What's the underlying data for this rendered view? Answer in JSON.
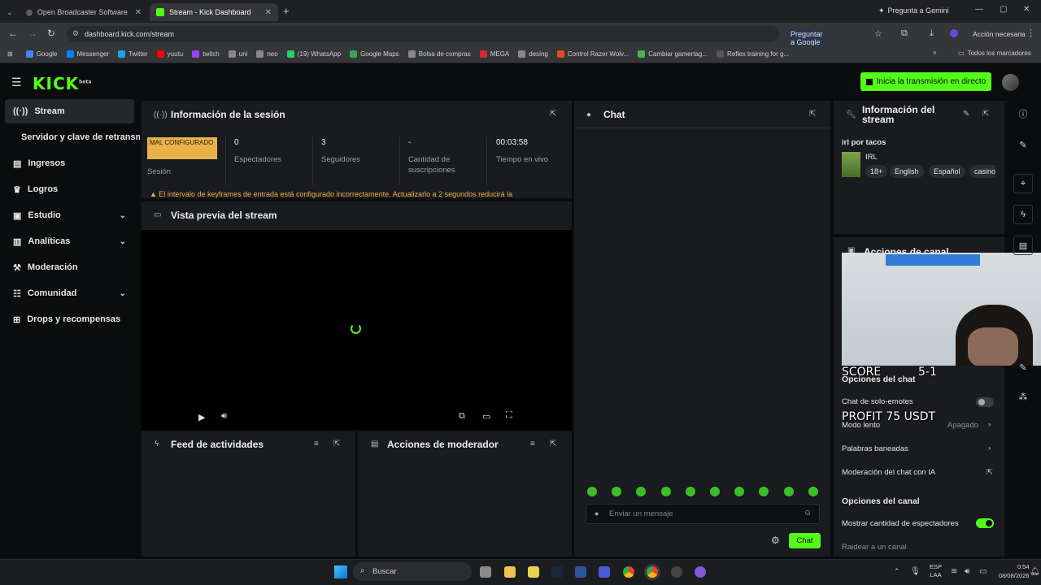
{
  "browser": {
    "tabs": [
      {
        "title": "Open Broadcaster Software | O"
      },
      {
        "title": "Stream - Kick Dashboard"
      }
    ],
    "url": "dashboard.kick.com/stream",
    "ask_google": "Preguntar a Google",
    "gemini": "Pregunta a Gemini",
    "action_needed": "Acción necesaria",
    "bookmarks": [
      "Google",
      "Messenger",
      "Twitter",
      "yuutu",
      "twitch",
      "uni",
      "neo",
      "(19) WhatsApp",
      "Google Maps",
      "Bolsa de compras",
      "MEGA",
      "desing",
      "Control Razer Wolv...",
      "Cambiar gamertag...",
      "Reflex training for g..."
    ],
    "all_bookmarks": "Todos los marcadores"
  },
  "header": {
    "logo": "KICK",
    "logo_sup": "beta",
    "go_live": "Inicia la transmisión en directo"
  },
  "sidebar": {
    "items": [
      {
        "label": "Stream"
      },
      {
        "label": "Servidor y clave de retransmisión"
      },
      {
        "label": "Ingresos"
      },
      {
        "label": "Logros"
      },
      {
        "label": "Estudio"
      },
      {
        "label": "Analíticas"
      },
      {
        "label": "Moderación"
      },
      {
        "label": "Comunidad"
      },
      {
        "label": "Drops y recompensas"
      }
    ]
  },
  "session": {
    "title": "Información de la sesión",
    "badge": "MAL CONFIGURADO",
    "session_label": "Sesión",
    "stats": [
      {
        "value": "0",
        "label": "Espectadores"
      },
      {
        "value": "3",
        "label": "Seguidores"
      },
      {
        "value": "-",
        "label": "Cantidad de suscripciones"
      },
      {
        "value": "00:03:58",
        "label": "Tiempo en vivo"
      }
    ],
    "warning": "El intervalo de keyframes de entrada está configurado incorrectamente. Actualizarlo a 2 segundos reducirá la"
  },
  "preview": {
    "title": "Vista previa del stream"
  },
  "activity": {
    "title": "Feed de actividades"
  },
  "modactions": {
    "title": "Acciones de moderador"
  },
  "chat": {
    "title": "Chat",
    "placeholder": "Enviar un mensaje",
    "send": "Chat"
  },
  "streaminfo": {
    "title": "Información del stream",
    "stream_title": "irl por tacos",
    "category": "IRL",
    "tags": [
      "18+",
      "English",
      "Español",
      "casino"
    ]
  },
  "channel_actions": {
    "title": "Acciones de canal"
  },
  "chat_options": {
    "title": "Opciones del chat",
    "emote_only": "Chat de solo-emotes",
    "slow_mode": "Modo lento",
    "slow_mode_value": "Apagado",
    "banned_words": "Palabras baneadas",
    "ai_moderation": "Moderación del chat con IA"
  },
  "channel_options": {
    "title": "Opciones del canal",
    "show_viewers": "Mostrar cantidad de espectadores",
    "raid": "Raidear a un canal"
  },
  "webcam": {
    "score_label": "SCORE",
    "score_value": "5-1",
    "profit": "PROFIT  75 USDT"
  },
  "taskbar": {
    "search": "Buscar",
    "lang_top": "ESP",
    "lang_bottom": "LAA",
    "time": "0:54",
    "date": "08/08/2026"
  },
  "colors": {
    "accent": "#53fc18",
    "warning": "#e8b24a",
    "panel": "#191b1f"
  }
}
